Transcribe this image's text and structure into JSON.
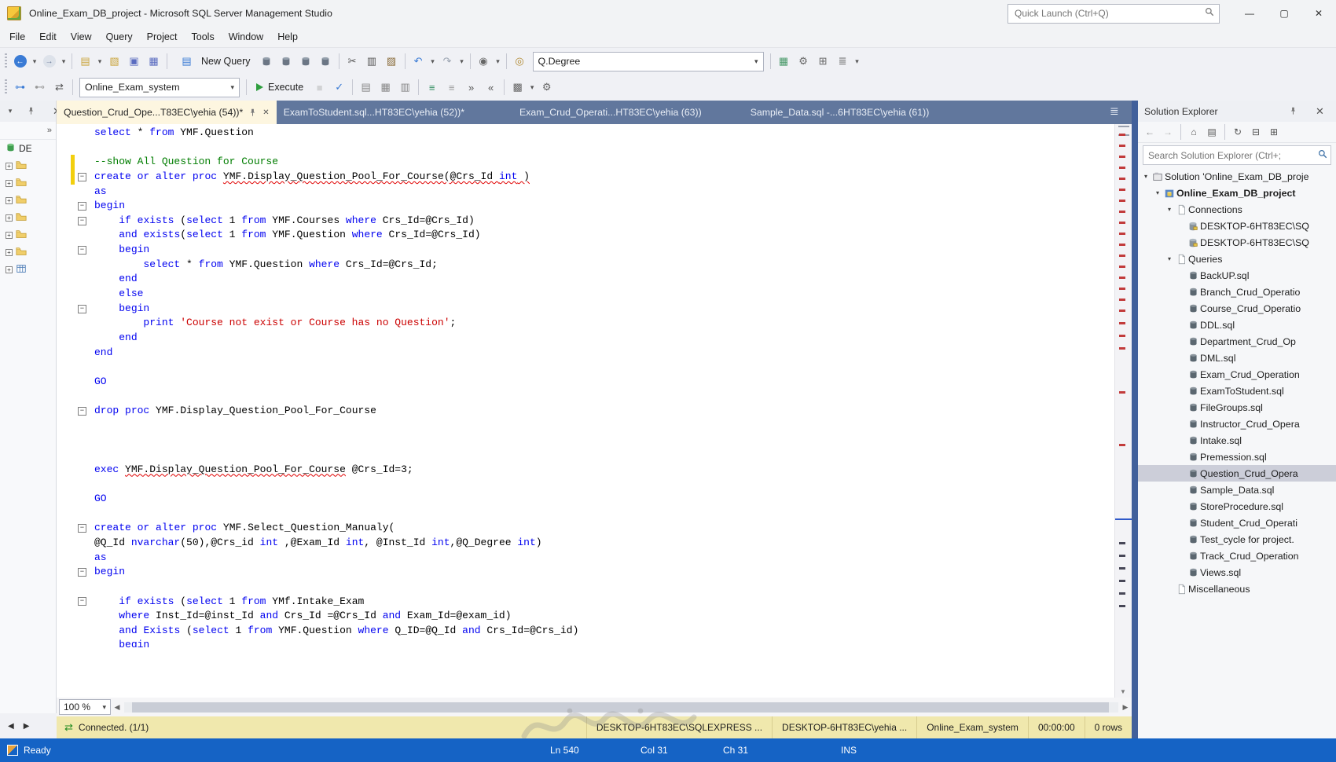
{
  "window": {
    "title": "Online_Exam_DB_project - Microsoft SQL Server Management Studio",
    "quick_launch_placeholder": "Quick Launch (Ctrl+Q)",
    "buttons": [
      "minimize-icon",
      "maximize-icon",
      "close-icon"
    ]
  },
  "menu": [
    "File",
    "Edit",
    "View",
    "Query",
    "Project",
    "Tools",
    "Window",
    "Help"
  ],
  "toolbar1": {
    "new_query_label": "New Query",
    "combo_value": "Q.Degree",
    "icons": [
      "grip",
      "nav-back-icon",
      "dropdown-caret",
      "nav-forward-icon",
      "dropdown-caret",
      "sep",
      "new-file-icon",
      "dropdown-caret",
      "open-file-icon",
      "save-icon",
      "save-all-icon",
      "sep",
      "NEW_QUERY",
      "mdx-query-icon",
      "dmx-query-icon",
      "xmla-query-icon",
      "dax-query-icon",
      "sep",
      "cut-icon",
      "copy-icon",
      "paste-icon",
      "sep",
      "undo-icon",
      "dropdown-caret",
      "redo-icon",
      "dropdown-caret",
      "sep",
      "selection-icon",
      "dropdown-caret",
      "sep",
      "navigate-icon",
      "COMBO_QDEGREE",
      "sep",
      "execution-plan-icon",
      "wrench-icon",
      "query-designer-icon",
      "templates-icon",
      "dropdown-caret"
    ]
  },
  "toolbar2": {
    "db_combo_value": "Online_Exam_system",
    "execute_label": "Execute",
    "icons": [
      "grip",
      "connect-icon",
      "disconnect-icon",
      "change-connection-icon",
      "sep",
      "COMBO_DB",
      "sep",
      "EXECUTE",
      "cancel-icon",
      "parse-icon",
      "sep",
      "results-text-icon",
      "results-grid-icon",
      "results-file-icon",
      "sep",
      "comment-icon",
      "uncomment-icon",
      "indent-icon",
      "outdent-icon",
      "sep",
      "sqlcmd-icon",
      "dropdown-caret",
      "query-options-icon"
    ]
  },
  "tabs": [
    {
      "label": "Question_Crud_Ope...T83EC\\yehia (54))*",
      "active": true
    },
    {
      "label": "ExamToStudent.sql...HT83EC\\yehia (52))*",
      "active": false
    },
    {
      "label": "Exam_Crud_Operati...HT83EC\\yehia (63))",
      "active": false
    },
    {
      "label": "Sample_Data.sql -...6HT83EC\\yehia (61))",
      "active": false
    }
  ],
  "left_panel": {
    "header_icons": [
      "dropdown-caret",
      "pin-icon",
      "close-icon"
    ],
    "overflow_icon": "chevron-right-double-icon",
    "header_label": "DE",
    "rows": [
      {
        "t": "folder"
      },
      {
        "t": "folder"
      },
      {
        "t": "folder"
      },
      {
        "t": "folder"
      },
      {
        "t": "folder"
      },
      {
        "t": "folder"
      },
      {
        "t": "table"
      }
    ]
  },
  "editor": {
    "zoom": "100 %",
    "lines": [
      {
        "s": [
          [
            "k",
            "select"
          ],
          [
            "d",
            " * "
          ],
          [
            "k",
            "from"
          ],
          [
            "d",
            " YMF.Question"
          ]
        ]
      },
      {
        "s": []
      },
      {
        "m": 1,
        "s": [
          [
            "c",
            "--show All Question for Course"
          ]
        ]
      },
      {
        "m": 1,
        "f": 1,
        "s": [
          [
            "k",
            "create"
          ],
          [
            "d",
            " "
          ],
          [
            "k",
            "or"
          ],
          [
            "d",
            " "
          ],
          [
            "k",
            "alter"
          ],
          [
            "d",
            " "
          ],
          [
            "k",
            "proc"
          ],
          [
            "d",
            " "
          ],
          [
            "d",
            "YMF.Display_Question_Pool_For_Course(@Crs_Id ",
            1
          ],
          [
            "k",
            "int",
            1
          ],
          [
            "d",
            " )",
            1
          ]
        ]
      },
      {
        "s": [
          [
            "k",
            "as"
          ]
        ]
      },
      {
        "f": 1,
        "s": [
          [
            "k",
            "begin"
          ]
        ]
      },
      {
        "f": 1,
        "s": [
          [
            "d",
            "    "
          ],
          [
            "k",
            "if"
          ],
          [
            "d",
            " "
          ],
          [
            "k",
            "exists"
          ],
          [
            "d",
            " ("
          ],
          [
            "k",
            "select"
          ],
          [
            "d",
            " 1 "
          ],
          [
            "k",
            "from"
          ],
          [
            "d",
            " YMF.Courses "
          ],
          [
            "k",
            "where"
          ],
          [
            "d",
            " Crs_Id=@Crs_Id)"
          ]
        ]
      },
      {
        "s": [
          [
            "d",
            "    "
          ],
          [
            "k",
            "and"
          ],
          [
            "d",
            " "
          ],
          [
            "k",
            "exists"
          ],
          [
            "d",
            "("
          ],
          [
            "k",
            "select"
          ],
          [
            "d",
            " 1 "
          ],
          [
            "k",
            "from"
          ],
          [
            "d",
            " YMF.Question "
          ],
          [
            "k",
            "where"
          ],
          [
            "d",
            " Crs_Id=@Crs_Id)"
          ]
        ]
      },
      {
        "f": 1,
        "s": [
          [
            "d",
            "    "
          ],
          [
            "k",
            "begin"
          ]
        ]
      },
      {
        "s": [
          [
            "d",
            "        "
          ],
          [
            "k",
            "select"
          ],
          [
            "d",
            " * "
          ],
          [
            "k",
            "from"
          ],
          [
            "d",
            " YMF.Question "
          ],
          [
            "k",
            "where"
          ],
          [
            "d",
            " Crs_Id=@Crs_Id;"
          ]
        ]
      },
      {
        "s": [
          [
            "d",
            "    "
          ],
          [
            "k",
            "end"
          ]
        ]
      },
      {
        "s": [
          [
            "d",
            "    "
          ],
          [
            "k",
            "else"
          ]
        ]
      },
      {
        "f": 1,
        "s": [
          [
            "d",
            "    "
          ],
          [
            "k",
            "begin"
          ]
        ]
      },
      {
        "s": [
          [
            "d",
            "        "
          ],
          [
            "k",
            "print"
          ],
          [
            "d",
            " "
          ],
          [
            "s",
            "'Course not exist or Course has no Question'"
          ],
          [
            "d",
            ";"
          ]
        ]
      },
      {
        "s": [
          [
            "d",
            "    "
          ],
          [
            "k",
            "end"
          ]
        ]
      },
      {
        "s": [
          [
            "k",
            "end"
          ]
        ]
      },
      {
        "s": []
      },
      {
        "s": [
          [
            "k",
            "GO"
          ]
        ]
      },
      {
        "s": []
      },
      {
        "f": 1,
        "s": [
          [
            "k",
            "drop"
          ],
          [
            "d",
            " "
          ],
          [
            "k",
            "proc"
          ],
          [
            "d",
            " YMF.Display_Question_Pool_For_Course"
          ]
        ]
      },
      {
        "s": []
      },
      {
        "s": []
      },
      {
        "s": []
      },
      {
        "s": [
          [
            "k",
            "exec"
          ],
          [
            "d",
            " "
          ],
          [
            "d",
            "YMF.Display_Question_Pool_For_Course",
            1
          ],
          [
            "d",
            " @Crs_Id=3;"
          ]
        ]
      },
      {
        "s": []
      },
      {
        "s": [
          [
            "k",
            "GO"
          ]
        ]
      },
      {
        "s": []
      },
      {
        "f": 1,
        "s": [
          [
            "k",
            "create"
          ],
          [
            "d",
            " "
          ],
          [
            "k",
            "or"
          ],
          [
            "d",
            " "
          ],
          [
            "k",
            "alter"
          ],
          [
            "d",
            " "
          ],
          [
            "k",
            "proc"
          ],
          [
            "d",
            " YMF.Select_Question_Manualy("
          ]
        ]
      },
      {
        "s": [
          [
            "d",
            "@Q_Id "
          ],
          [
            "k",
            "nvarchar"
          ],
          [
            "d",
            "(50),@Crs_id "
          ],
          [
            "k",
            "int"
          ],
          [
            "d",
            " ,@Exam_Id "
          ],
          [
            "k",
            "int"
          ],
          [
            "d",
            ", @Inst_Id "
          ],
          [
            "k",
            "int"
          ],
          [
            "d",
            ",@Q_Degree "
          ],
          [
            "k",
            "int"
          ],
          [
            "d",
            ")"
          ]
        ]
      },
      {
        "s": [
          [
            "k",
            "as"
          ]
        ]
      },
      {
        "f": 1,
        "s": [
          [
            "k",
            "begin"
          ]
        ]
      },
      {
        "s": []
      },
      {
        "f": 1,
        "s": [
          [
            "d",
            "    "
          ],
          [
            "k",
            "if"
          ],
          [
            "d",
            " "
          ],
          [
            "k",
            "exists"
          ],
          [
            "d",
            " ("
          ],
          [
            "k",
            "select"
          ],
          [
            "d",
            " 1 "
          ],
          [
            "k",
            "from"
          ],
          [
            "d",
            " YMf.Intake_Exam"
          ]
        ]
      },
      {
        "s": [
          [
            "d",
            "    "
          ],
          [
            "k",
            "where"
          ],
          [
            "d",
            " Inst_Id=@inst_Id "
          ],
          [
            "k",
            "and"
          ],
          [
            "d",
            " Crs_Id =@Crs_Id "
          ],
          [
            "k",
            "and"
          ],
          [
            "d",
            " Exam_Id=@exam_id)"
          ]
        ]
      },
      {
        "s": [
          [
            "d",
            "    "
          ],
          [
            "k",
            "and"
          ],
          [
            "d",
            " "
          ],
          [
            "k",
            "Exists"
          ],
          [
            "d",
            " ("
          ],
          [
            "k",
            "select"
          ],
          [
            "d",
            " 1 "
          ],
          [
            "k",
            "from"
          ],
          [
            "d",
            " YMF.Question "
          ],
          [
            "k",
            "where"
          ],
          [
            "d",
            " Q_ID=@Q_Id "
          ],
          [
            "k",
            "and"
          ],
          [
            "d",
            " Crs_Id=@Crs_id)"
          ]
        ]
      },
      {
        "s": [
          [
            "d",
            "    "
          ],
          [
            "k",
            "begin"
          ]
        ]
      }
    ],
    "scroll_marks": {
      "red": [
        12,
        26,
        40,
        54,
        68,
        82,
        96,
        110,
        124,
        138,
        152,
        166,
        180,
        194,
        208,
        222,
        236,
        252,
        268,
        284,
        340,
        407
      ],
      "dark": [
        532,
        548,
        564,
        580,
        596,
        612
      ],
      "blue": 502
    }
  },
  "connection_bar": {
    "status": "Connected. (1/1)",
    "segments": [
      "DESKTOP-6HT83EC\\SQLEXPRESS ...",
      "DESKTOP-6HT83EC\\yehia ...",
      "Online_Exam_system",
      "00:00:00",
      "0 rows"
    ]
  },
  "status_bar": {
    "ready": "Ready",
    "ln": "Ln 540",
    "col": "Col 31",
    "ch": "Ch 31",
    "mode": "INS"
  },
  "solution_explorer": {
    "title": "Solution Explorer",
    "header_icons": [
      "pin-icon",
      "close-icon"
    ],
    "toolbar_icons": [
      "se-back-icon",
      "se-forward-icon",
      "sep",
      "home-icon",
      "show-all-icon",
      "sep",
      "sync-icon",
      "collapse-all-icon",
      "properties-icon"
    ],
    "search_placeholder": "Search Solution Explorer (Ctrl+;",
    "tree": [
      {
        "d": 0,
        "a": 1,
        "i": "solution",
        "t": "Solution 'Online_Exam_DB_proje"
      },
      {
        "d": 1,
        "a": 1,
        "i": "project",
        "t": "Online_Exam_DB_project",
        "b": 1
      },
      {
        "d": 2,
        "a": 1,
        "i": "page",
        "t": "Connections"
      },
      {
        "d": 3,
        "i": "server",
        "t": "DESKTOP-6HT83EC\\SQ"
      },
      {
        "d": 3,
        "i": "server",
        "t": "DESKTOP-6HT83EC\\SQ"
      },
      {
        "d": 2,
        "a": 1,
        "i": "page",
        "t": "Queries"
      },
      {
        "d": 3,
        "i": "dbfile",
        "t": "BackUP.sql"
      },
      {
        "d": 3,
        "i": "dbfile",
        "t": "Branch_Crud_Operatio"
      },
      {
        "d": 3,
        "i": "dbfile",
        "t": "Course_Crud_Operatio"
      },
      {
        "d": 3,
        "i": "dbfile",
        "t": "DDL.sql"
      },
      {
        "d": 3,
        "i": "dbfile",
        "t": "Department_Crud_Op"
      },
      {
        "d": 3,
        "i": "dbfile",
        "t": "DML.sql"
      },
      {
        "d": 3,
        "i": "dbfile",
        "t": "Exam_Crud_Operation"
      },
      {
        "d": 3,
        "i": "dbfile",
        "t": "ExamToStudent.sql"
      },
      {
        "d": 3,
        "i": "dbfile",
        "t": "FileGroups.sql"
      },
      {
        "d": 3,
        "i": "dbfile",
        "t": "Instructor_Crud_Opera"
      },
      {
        "d": 3,
        "i": "dbfile",
        "t": "Intake.sql"
      },
      {
        "d": 3,
        "i": "dbfile",
        "t": "Premession.sql"
      },
      {
        "d": 3,
        "i": "dbfile",
        "t": "Question_Crud_Opera",
        "sel": 1
      },
      {
        "d": 3,
        "i": "dbfile",
        "t": "Sample_Data.sql"
      },
      {
        "d": 3,
        "i": "dbfile",
        "t": "StoreProcedure.sql"
      },
      {
        "d": 3,
        "i": "dbfile",
        "t": "Student_Crud_Operati"
      },
      {
        "d": 3,
        "i": "dbfile",
        "t": "Test_cycle for project."
      },
      {
        "d": 3,
        "i": "dbfile",
        "t": "Track_Crud_Operation"
      },
      {
        "d": 3,
        "i": "dbfile",
        "t": "Views.sql"
      },
      {
        "d": 2,
        "i": "page",
        "t": "Miscellaneous"
      }
    ]
  }
}
